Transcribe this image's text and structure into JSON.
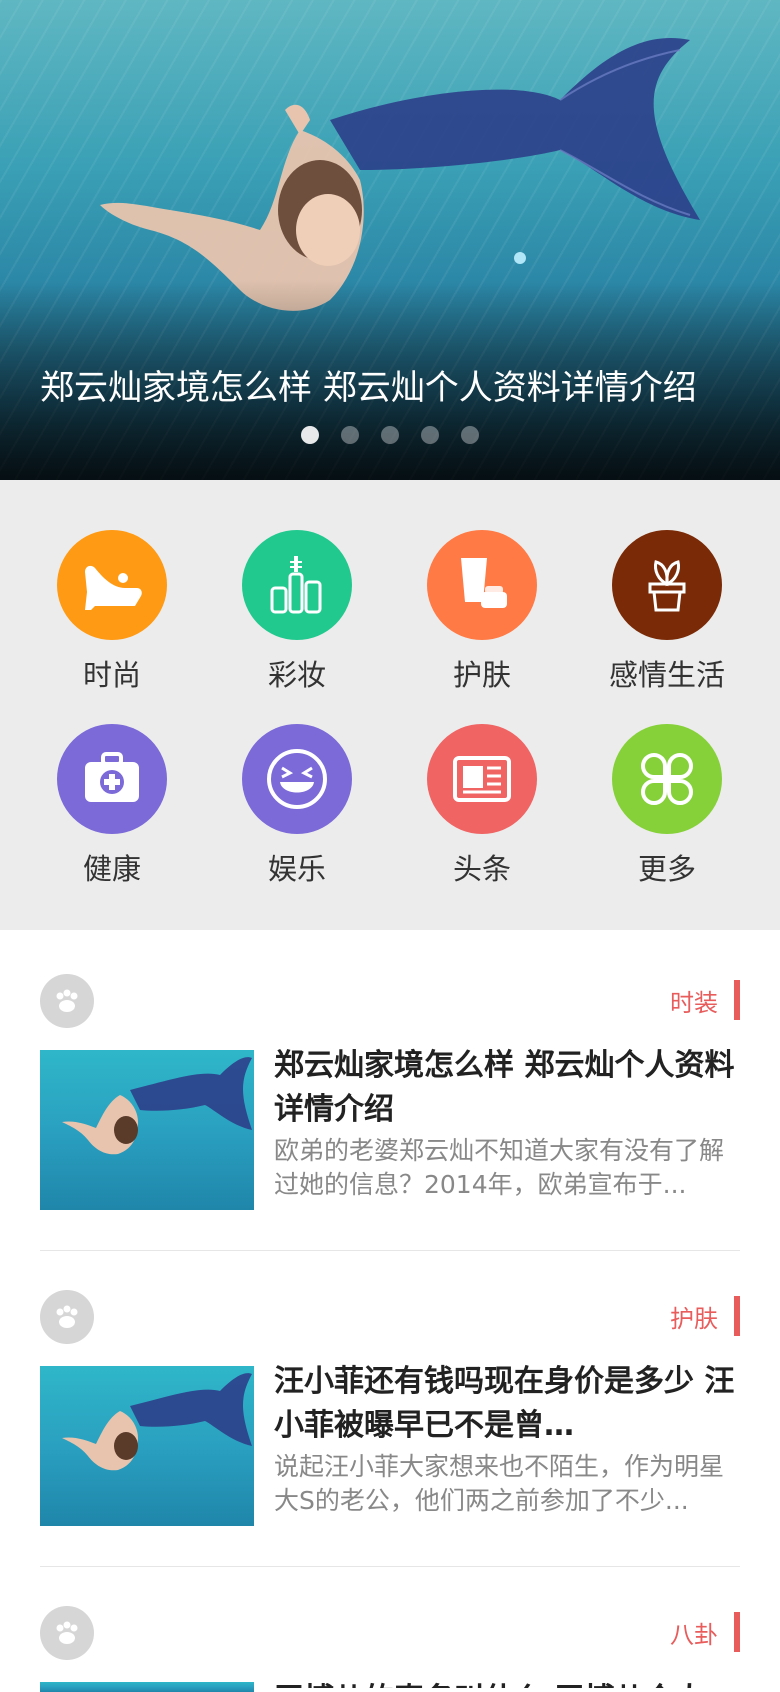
{
  "banner": {
    "title": "郑云灿家境怎么样 郑云灿个人资料详情介绍",
    "dots": 5,
    "active_dot": 0
  },
  "categories": [
    {
      "label": "时尚",
      "color": "#ff9a14",
      "icon": "high-heel-icon"
    },
    {
      "label": "彩妆",
      "color": "#22c98f",
      "icon": "makeup-icon"
    },
    {
      "label": "护肤",
      "color": "#ff7a45",
      "icon": "skincare-icon"
    },
    {
      "label": "感情生活",
      "color": "#7a2a06",
      "icon": "plant-icon"
    },
    {
      "label": "健康",
      "color": "#7c6ad8",
      "icon": "medical-kit-icon"
    },
    {
      "label": "娱乐",
      "color": "#7c6ad8",
      "icon": "laugh-face-icon"
    },
    {
      "label": "头条",
      "color": "#f06464",
      "icon": "newspaper-icon"
    },
    {
      "label": "更多",
      "color": "#86d13a",
      "icon": "clover-icon"
    }
  ],
  "articles": [
    {
      "tag": "时装",
      "title": "郑云灿家境怎么样 郑云灿个人资料详情介绍",
      "desc": "欧弟的老婆郑云灿不知道大家有没有了解过她的信息？2014年，欧弟宣布于..."
    },
    {
      "tag": "护肤",
      "title": "汪小菲还有钱吗现在身价是多少 汪小菲被曝早已不是曾…",
      "desc": "说起汪小菲大家想来也不陌生，作为明星大S的老公，他们两之前参加了不少..."
    },
    {
      "tag": "八卦",
      "title": "王博儿的真名叫什么 王博儿个人",
      "desc": ""
    }
  ]
}
